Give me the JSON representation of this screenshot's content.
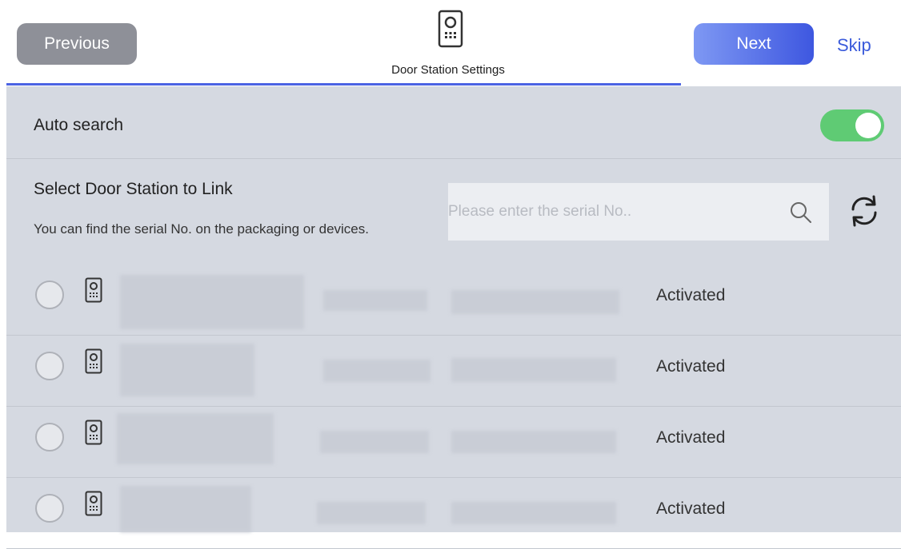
{
  "header": {
    "previous_label": "Previous",
    "next_label": "Next",
    "skip_label": "Skip",
    "title": "Door Station Settings",
    "accent_color": "#4b63e3"
  },
  "auto_search": {
    "label": "Auto search",
    "enabled": true
  },
  "select": {
    "title": "Select Door Station to Link",
    "hint": "You can find the serial No. on the packaging or devices."
  },
  "search": {
    "placeholder": "Please enter the serial No..",
    "value": ""
  },
  "devices": [
    {
      "status": "Activated"
    },
    {
      "status": "Activated"
    },
    {
      "status": "Activated"
    },
    {
      "status": "Activated"
    }
  ],
  "icons": {
    "station": "door-station-icon",
    "search": "search-icon",
    "refresh": "refresh-icon"
  }
}
